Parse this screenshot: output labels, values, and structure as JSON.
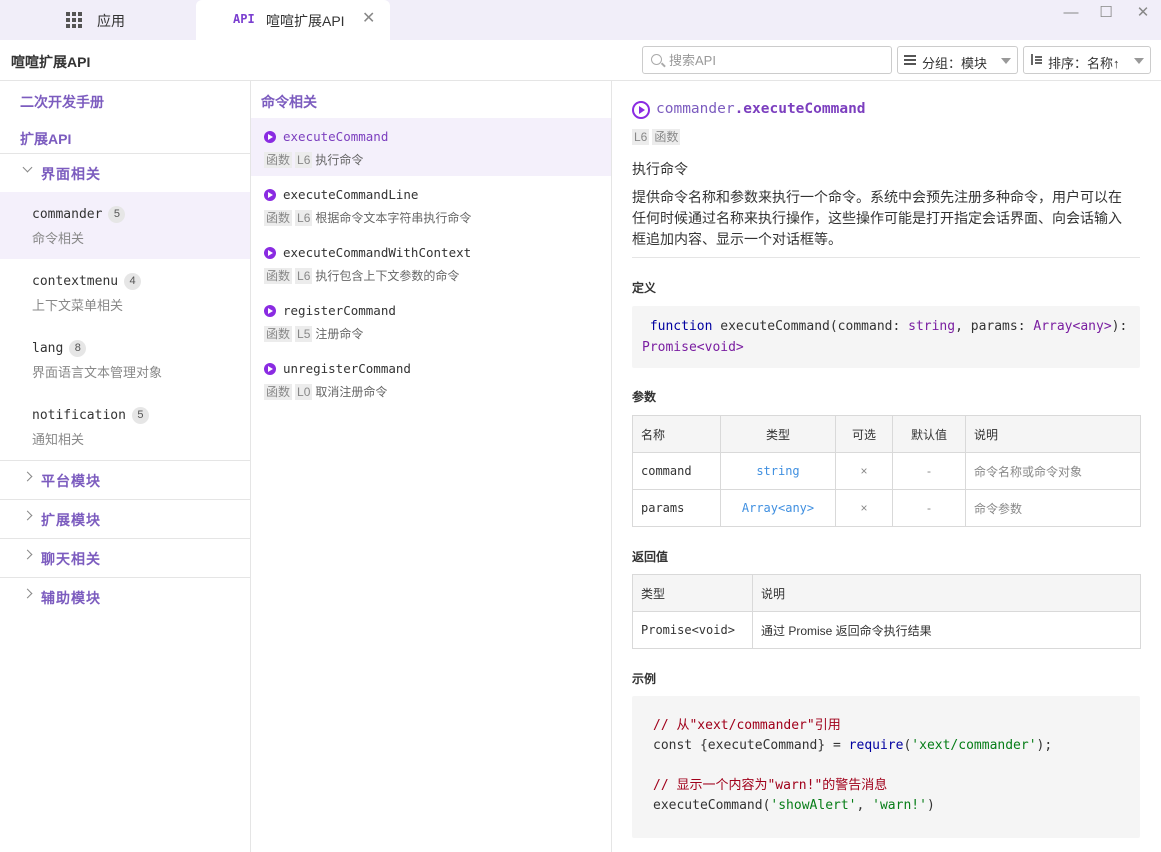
{
  "titlebar": {
    "apps_tab_label": "应用",
    "active_tab_badge": "API",
    "active_tab_label": "喧喧扩展API",
    "close_glyph": "✕",
    "minimize_glyph": "—",
    "maximize_glyph": "☐",
    "window_close_glyph": "✕"
  },
  "toolbar": {
    "title": "喧喧扩展API",
    "search_placeholder": "搜索API",
    "group_label": "分组：模块",
    "sort_label": "排序：名称↑"
  },
  "sidebar": {
    "manual_link": "二次开发手册",
    "api_link": "扩展API",
    "groups": [
      {
        "label": "界面相关",
        "expanded": true
      },
      {
        "label": "平台模块",
        "expanded": false
      },
      {
        "label": "扩展模块",
        "expanded": false
      },
      {
        "label": "聊天相关",
        "expanded": false
      },
      {
        "label": "辅助模块",
        "expanded": false
      }
    ],
    "modules": [
      {
        "name": "commander",
        "count": "5",
        "desc": "命令相关",
        "selected": true
      },
      {
        "name": "contextmenu",
        "count": "4",
        "desc": "上下文菜单相关"
      },
      {
        "name": "lang",
        "count": "8",
        "desc": "界面语言文本管理对象"
      },
      {
        "name": "notification",
        "count": "5",
        "desc": "通知相关"
      }
    ]
  },
  "middle": {
    "header": "命令相关",
    "items": [
      {
        "name": "executeCommand",
        "kind": "函数",
        "line": "L6",
        "desc": "执行命令",
        "selected": true
      },
      {
        "name": "executeCommandLine",
        "kind": "函数",
        "line": "L6",
        "desc": "根据命令文本字符串执行命令"
      },
      {
        "name": "executeCommandWithContext",
        "kind": "函数",
        "line": "L6",
        "desc": "执行包含上下文参数的命令"
      },
      {
        "name": "registerCommand",
        "kind": "函数",
        "line": "L5",
        "desc": "注册命令"
      },
      {
        "name": "unregisterCommand",
        "kind": "函数",
        "line": "L0",
        "desc": "取消注册命令"
      }
    ]
  },
  "detail": {
    "namespace": "commander",
    "function": ".executeCommand",
    "line": "L6",
    "kind": "函数",
    "brief": "执行命令",
    "description": "提供命令名称和参数来执行一个命令。系统中会预先注册多种命令，用户可以在任何时候通过名称来执行操作，这些操作可能是打开指定会话界面、向会话输入框追加内容、显示一个对话框等。",
    "definition_heading": "定义",
    "definition": {
      "kw": "function",
      "name": " executeCommand(command: ",
      "t1": "string",
      "mid": ", params: ",
      "t2": "Array<any>",
      "end": "):",
      "ret": "Promise<void>"
    },
    "params_heading": "参数",
    "params_columns": [
      "名称",
      "类型",
      "可选",
      "默认值",
      "说明"
    ],
    "params": [
      {
        "name": "command",
        "type": "string",
        "optional": "×",
        "default": "-",
        "desc": "命令名称或命令对象"
      },
      {
        "name": "params",
        "type": "Array<any>",
        "optional": "×",
        "default": "-",
        "desc": "命令参数"
      }
    ],
    "returns_heading": "返回值",
    "returns_columns": [
      "类型",
      "说明"
    ],
    "returns": {
      "type": "Promise<void>",
      "desc": "通过 Promise 返回命令执行结果"
    },
    "example_heading": "示例",
    "example": {
      "c1": "// 从\"xext/commander\"引用",
      "l2a": "const {executeCommand} = ",
      "l2fn": "require",
      "l2b": "(",
      "l2s": "'xext/commander'",
      "l2c": ");",
      "c2": "// 显示一个内容为\"warn!\"的警告消息",
      "l4a": "executeCommand(",
      "l4s1": "'showAlert'",
      "l4b": ", ",
      "l4s2": "'warn!'",
      "l4c": ")"
    }
  }
}
